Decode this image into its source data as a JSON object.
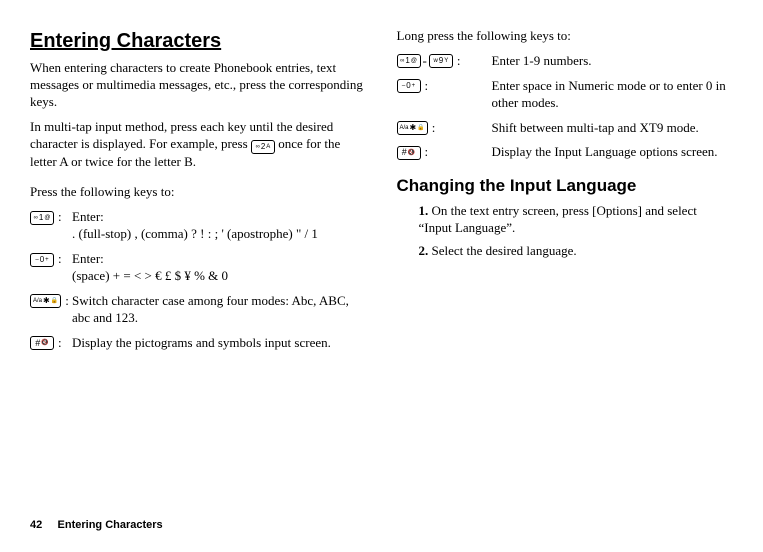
{
  "col1": {
    "heading": "Entering Characters",
    "para1": "When entering characters to create Phonebook entries, text messages or multimedia messages, etc., press the corresponding keys.",
    "para2a": "In multi-tap input method, press each key until the desired character is displayed. For example, press ",
    "para2b": " once for the letter A or twice for the letter B.",
    "pressIntro": "Press the following keys to:",
    "rows": [
      {
        "label": "Enter:",
        "detail": ". (full-stop) , (comma) ? ! : ; ' (apostrophe) \" / 1"
      },
      {
        "label": "Enter:",
        "detail": "(space) + = < > € £ $ ¥ % & 0"
      },
      {
        "label": "Switch character case among four modes: Abc, ABC, abc and 123.",
        "detail": ""
      },
      {
        "label": "Display the pictograms and symbols input screen.",
        "detail": ""
      }
    ]
  },
  "col2": {
    "longPressIntro": "Long press the following keys to:",
    "rows": [
      {
        "label": "Enter 1-9 numbers."
      },
      {
        "label": "Enter space in Numeric mode or to enter 0 in other modes."
      },
      {
        "label": "Shift between multi-tap and XT9 mode."
      },
      {
        "label": "Display the Input Language options screen."
      }
    ],
    "heading2": "Changing the Input Language",
    "step1": "On the text entry screen, press [Options] and select “Input Language”.",
    "step2": "Select the desired language."
  },
  "keycaps": {
    "k1": "1",
    "k2": "2",
    "k0": "0",
    "k9": "9",
    "star": "✱",
    "abc": "A/a",
    "hash": "#",
    "rangeDash": "-"
  },
  "footer": {
    "page": "42",
    "title": "Entering Characters"
  }
}
